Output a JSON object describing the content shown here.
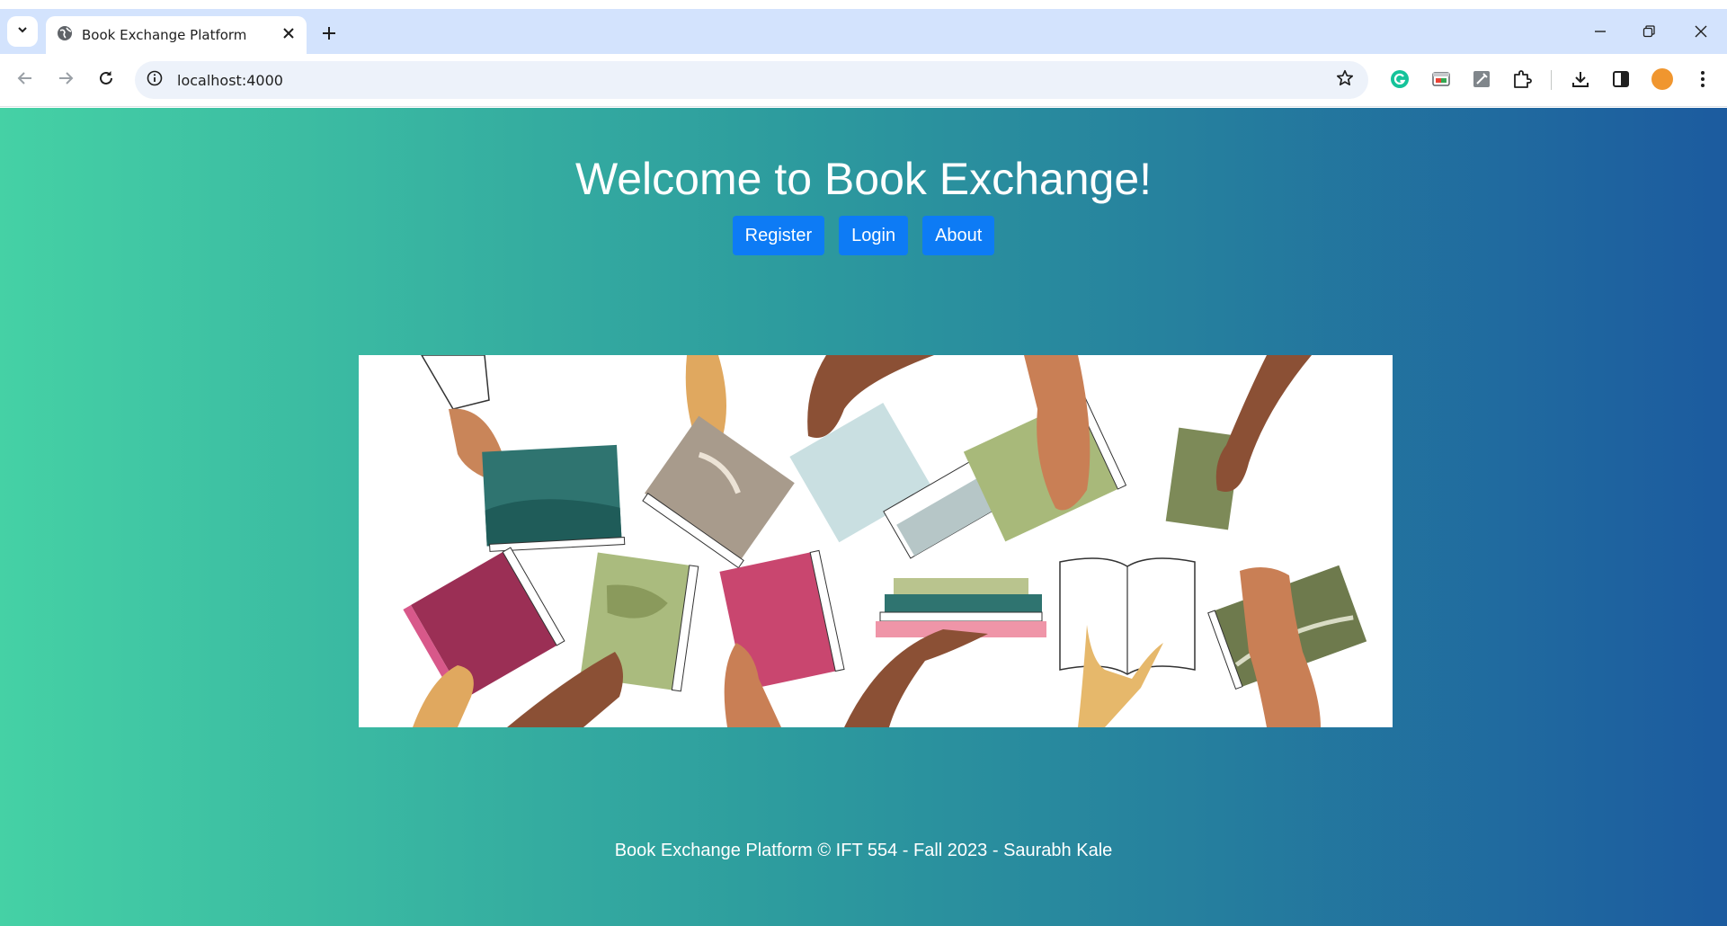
{
  "browser": {
    "tab_title": "Book Exchange Platform",
    "url": "localhost:4000",
    "icons": [
      "tab-search-icon",
      "globe-icon",
      "close-icon",
      "plus-icon",
      "minimize-icon",
      "restore-icon",
      "window-close-icon",
      "back-icon",
      "forward-icon",
      "reload-icon",
      "info-icon",
      "star-icon",
      "grammarly-icon",
      "extension-screen-icon",
      "extension-pen-icon",
      "puzzle-icon",
      "download-icon",
      "side-panel-icon",
      "avatar",
      "menu-icon"
    ],
    "colors": {
      "tabstrip": "#d3e3fd",
      "omnibox": "#edf2fa",
      "avatar": "#f0962f"
    }
  },
  "page": {
    "heading": "Welcome to Book Exchange!",
    "nav": {
      "register": "Register",
      "login": "Login",
      "about": "About"
    },
    "footer": "Book Exchange Platform © IFT 554 - Fall 2023 - Saurabh Kale",
    "colors": {
      "gradient_start": "#45d1a5",
      "gradient_end": "#1c5b9f",
      "button": "#0d7bf5"
    }
  }
}
